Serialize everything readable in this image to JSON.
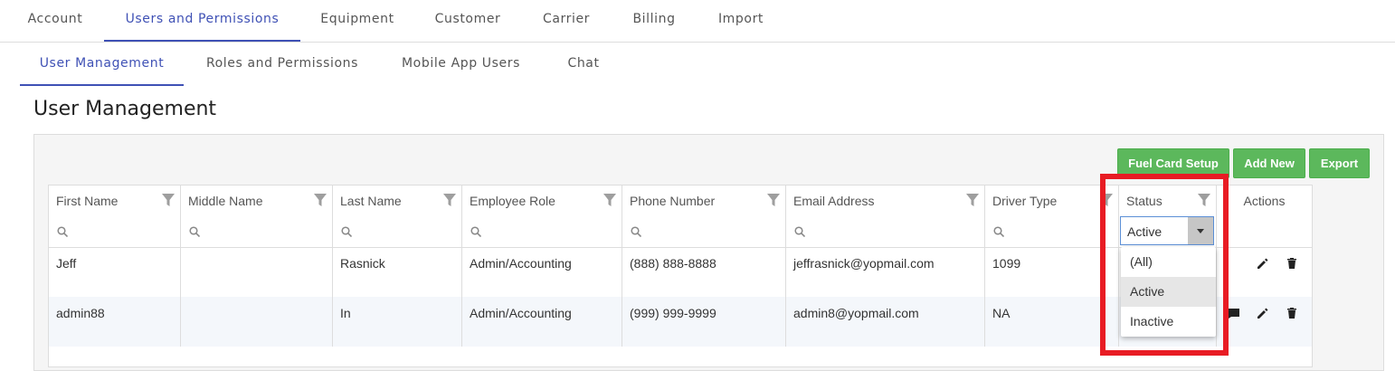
{
  "top_tabs": [
    "Account",
    "Users and Permissions",
    "Equipment",
    "Customer",
    "Carrier",
    "Billing",
    "Import"
  ],
  "sub_tabs": [
    "User Management",
    "Roles and Permissions",
    "Mobile App Users",
    "Chat"
  ],
  "page_title": "User Management",
  "buttons": {
    "fuel_card": "Fuel Card Setup",
    "add_new": "Add New",
    "export": "Export"
  },
  "columns": [
    "First Name",
    "Middle Name",
    "Last Name",
    "Employee Role",
    "Phone Number",
    "Email Address",
    "Driver Type",
    "Status",
    "Actions"
  ],
  "status_filter": {
    "value": "Active",
    "options": [
      "(All)",
      "Active",
      "Inactive"
    ],
    "selected": "Active"
  },
  "rows": [
    {
      "first": "Jeff",
      "middle": "",
      "last": "Rasnick",
      "role": "Admin/Accounting",
      "phone": "(888) 888-8888",
      "email": "jeffrasnick@yopmail.com",
      "driver_type": "1099"
    },
    {
      "first": "admin88",
      "middle": "",
      "last": "In",
      "role": "Admin/Accounting",
      "phone": "(999) 999-9999",
      "email": "admin8@yopmail.com",
      "driver_type": "NA"
    }
  ],
  "colors": {
    "accent": "#3f51b5",
    "button_green": "#5cb85c",
    "highlight": "#e81c24"
  }
}
